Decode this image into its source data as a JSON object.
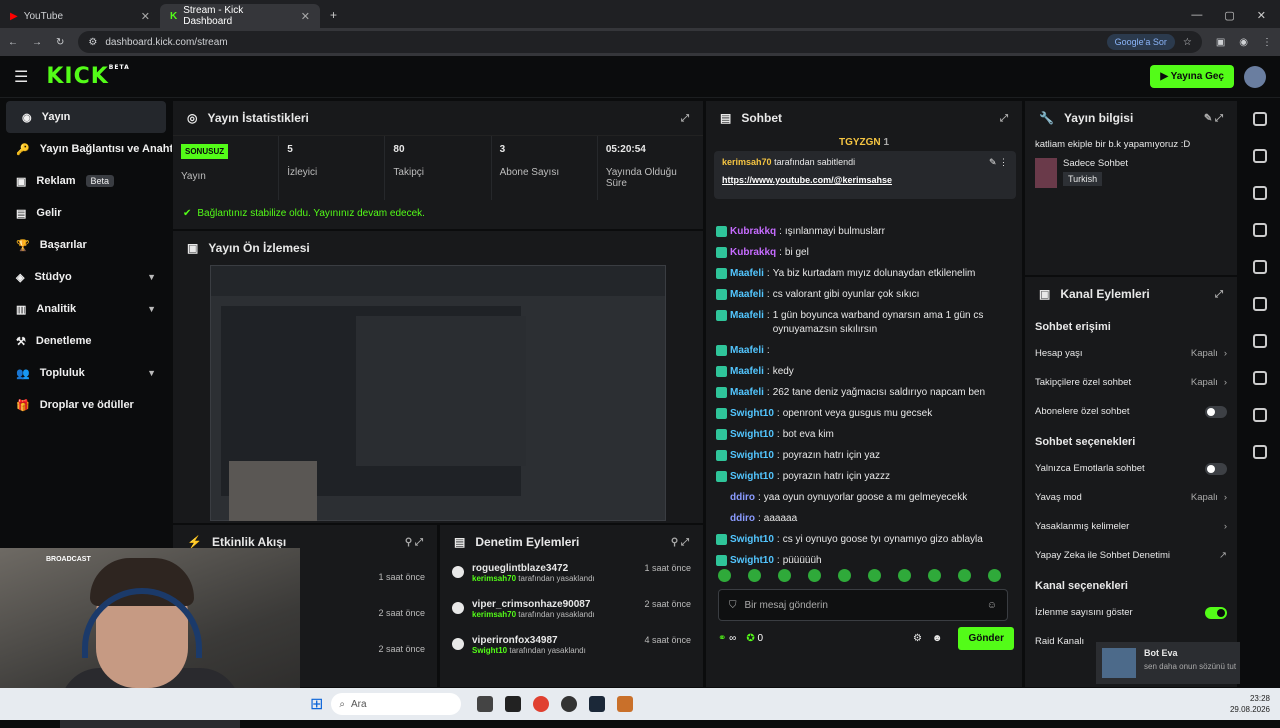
{
  "browser": {
    "tabs": [
      {
        "label": "YouTube"
      },
      {
        "label": "Stream - Kick Dashboard"
      }
    ],
    "url": "dashboard.kick.com/stream",
    "google_btn": "Google'a Sor"
  },
  "header": {
    "logo": "KICK",
    "beta": "BETA",
    "go_live": "Yayına Geç"
  },
  "sidebar": {
    "items": [
      {
        "label": "Yayın"
      },
      {
        "label": "Yayın Bağlantısı ve Anahtar"
      },
      {
        "label": "Reklam",
        "badge": "Beta"
      },
      {
        "label": "Gelir"
      },
      {
        "label": "Başarılar"
      },
      {
        "label": "Stüdyo"
      },
      {
        "label": "Analitik"
      },
      {
        "label": "Denetleme"
      },
      {
        "label": "Topluluk"
      },
      {
        "label": "Droplar ve ödüller"
      }
    ]
  },
  "stats": {
    "title": "Yayın İstatistikleri",
    "status_badge": "SONUSUZ",
    "items": [
      {
        "value": "",
        "label": "Yayın"
      },
      {
        "value": "5",
        "label": "İzleyici"
      },
      {
        "value": "80",
        "label": "Takipçi"
      },
      {
        "value": "3",
        "label": "Abone Sayısı"
      },
      {
        "value": "05:20:54",
        "label": "Yayında Olduğu Süre"
      }
    ],
    "stable_msg": "Bağlantınız stabilize oldu. Yayınınız devam edecek."
  },
  "preview": {
    "title": "Yayın Ön İzlemesi"
  },
  "webcam": {
    "overlay": "BROADCAST"
  },
  "activity": {
    "title": "Etkinlik Akışı",
    "rows": [
      {
        "time": "1 saat önce"
      },
      {
        "time": "2 saat önce"
      },
      {
        "time": "2 saat önce"
      }
    ]
  },
  "moderation": {
    "title": "Denetim Eylemleri",
    "rows": [
      {
        "user": "rogueglintblaze3472",
        "by": "kerimsah70",
        "suffix": "tarafından yasaklandı",
        "time": "1 saat önce"
      },
      {
        "user": "viper_crimsonhaze90087",
        "by": "kerimsah70",
        "suffix": "tarafından yasaklandı",
        "time": "2 saat önce"
      },
      {
        "user": "viperironfox34987",
        "by": "Swight10",
        "suffix": "tarafından yasaklandı",
        "time": "4 saat önce"
      }
    ]
  },
  "chat": {
    "title": "Sohbet",
    "top_user": "TGYZGN",
    "top_count": "1",
    "pinned_by": "kerimsah70",
    "pinned_suffix": "tarafından sabitlendi",
    "pinned_link": "https://www.youtube.com/@kerimsahse",
    "messages": [
      {
        "user": "Kubrakkq",
        "color": "#c66cff",
        "text": "ışınlanmayi bulmuslarr"
      },
      {
        "user": "Kubrakkq",
        "color": "#c66cff",
        "text": "bi gel"
      },
      {
        "user": "Maafeli",
        "color": "#53c6ff",
        "text": "Ya biz kurtadam mıyız dolunaydan etkilenelim"
      },
      {
        "user": "Maafeli",
        "color": "#53c6ff",
        "text": "cs valorant gibi oyunlar çok sıkıcı"
      },
      {
        "user": "Maafeli",
        "color": "#53c6ff",
        "text": "1 gün boyunca warband oynarsın ama 1 gün cs oynuyamazsın sıkılırsın"
      },
      {
        "user": "Maafeli",
        "color": "#53c6ff",
        "text": ""
      },
      {
        "user": "Maafeli",
        "color": "#53c6ff",
        "text": "kedy"
      },
      {
        "user": "Maafeli",
        "color": "#53c6ff",
        "text": "262 tane deniz yağmacısı saldırıyo napcam ben"
      },
      {
        "user": "Swight10",
        "color": "#53c6ff",
        "text": "openront veya gusgus mu gecsek"
      },
      {
        "user": "Swight10",
        "color": "#53c6ff",
        "text": "bot eva kim"
      },
      {
        "user": "Swight10",
        "color": "#53c6ff",
        "text": "poyrazın hatrı için yaz"
      },
      {
        "user": "Swight10",
        "color": "#53c6ff",
        "text": "poyrazın hatrı için yazzz"
      },
      {
        "user": "ddiro",
        "color": "#8a9bff",
        "text": "yaa oyun oynuyorlar goose a mı gelmeyecekk"
      },
      {
        "user": "ddiro",
        "color": "#8a9bff",
        "text": "aaaaaa"
      },
      {
        "user": "Swight10",
        "color": "#53c6ff",
        "text": "cs yi oynuyo goose tyı oynamıyo gizo ablayla"
      },
      {
        "user": "Swight10",
        "color": "#53c6ff",
        "text": "püüüüüh"
      }
    ],
    "input_placeholder": "Bir mesaj gönderin",
    "count_a": "∞",
    "count_b": "0",
    "send": "Gönder"
  },
  "stream_info": {
    "title": "Yayın bilgisi",
    "desc": "katliam ekiple bir b.k yapamıyoruz :D",
    "category": "Sadece Sohbet",
    "language": "Turkish"
  },
  "channel_actions": {
    "title": "Kanal Eylemleri",
    "sections": [
      {
        "heading": "Sohbet erişimi",
        "options": [
          {
            "label": "Hesap yaşı",
            "value": "Kapalı",
            "type": "arrow"
          },
          {
            "label": "Takipçilere özel sohbet",
            "value": "Kapalı",
            "type": "arrow"
          },
          {
            "label": "Abonelere özel sohbet",
            "value": "",
            "type": "toggle"
          }
        ]
      },
      {
        "heading": "Sohbet seçenekleri",
        "options": [
          {
            "label": "Yalnızca Emotlarla sohbet",
            "value": "",
            "type": "toggle"
          },
          {
            "label": "Yavaş mod",
            "value": "Kapalı",
            "type": "arrow"
          },
          {
            "label": "Yasaklanmış kelimeler",
            "value": "",
            "type": "arrow"
          },
          {
            "label": "Yapay Zeka ile Sohbet Denetimi",
            "value": "",
            "type": "link"
          }
        ]
      },
      {
        "heading": "Kanal seçenekleri",
        "options": [
          {
            "label": "İzlenme sayısını göster",
            "value": "",
            "type": "toggle-on"
          },
          {
            "label": "Raid Kanalı",
            "value": "",
            "type": "none"
          }
        ]
      }
    ],
    "raid_name": "Bot Eva",
    "raid_msg": "sen daha onun sözünü tut"
  },
  "taskbar": {
    "search": "Ara",
    "time": "23:28",
    "date": "29.08.2026"
  }
}
